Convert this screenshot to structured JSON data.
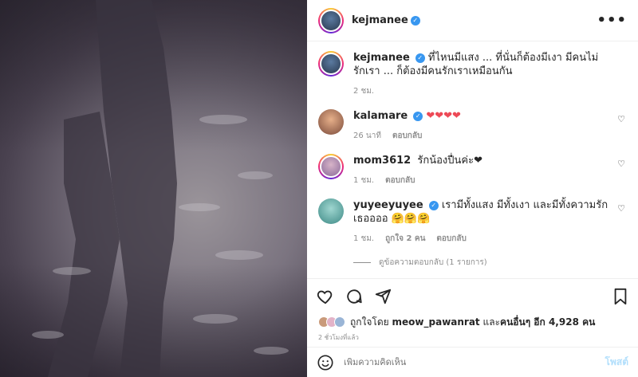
{
  "post": {
    "username": "kejmanee",
    "more_label": "•••",
    "caption": "ที่ไหนมีแสง ... ที่นั่นก็ต้องมีเงา มีคนไม่รักเรา ... ก็ต้องมีคนรักเราเหมือนกัน",
    "caption_time": "2 ชม."
  },
  "comments": [
    {
      "user": "kalamare",
      "text": "❤❤❤❤",
      "time": "26 นาที",
      "reply": "ตอบกลับ",
      "likes": ""
    },
    {
      "user": "mom3612",
      "text": "รักน้องปื่นค่ะ❤",
      "time": "1 ชม.",
      "reply": "ตอบกลับ",
      "likes": ""
    },
    {
      "user": "yuyeeyuyee",
      "text": "เรามีทั้งแสง มีทั้งเงา และมีทั้งความรัก เธออออ 🤗🤗🤗",
      "time": "1 ชม.",
      "likes": "ถูกใจ 2 คน",
      "reply": "ตอบกลับ"
    }
  ],
  "view_replies": "ดูข้อความตอบกลับ (1 รายการ)",
  "likes_line": {
    "prefix": "ถูกใจโดย",
    "user": "meow_pawanrat",
    "middle": "และ",
    "others": "คนอื่นๆ อีก 4,928 คน"
  },
  "timestamp": "2 ชั่วโมงที่แล้ว",
  "compose": {
    "placeholder": "เพิ่มความคิดเห็น",
    "post_label": "โพสต์"
  },
  "colors": {
    "verified": "#3897f0",
    "heart": "#ed4956",
    "post_disabled": "#b2dffc"
  }
}
